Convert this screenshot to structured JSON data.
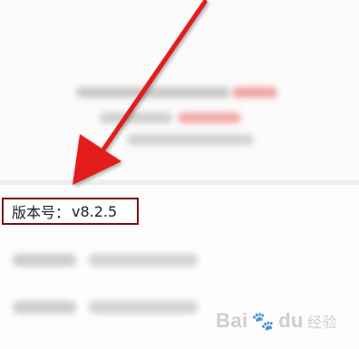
{
  "version": {
    "label": "版本号：",
    "value": "v8.2.5"
  },
  "watermark": {
    "brand": "Bai",
    "brand_suffix": "du",
    "cn": "经验"
  },
  "colors": {
    "arrow": "#e31b1b",
    "highlight_box": "#7a0f12"
  }
}
